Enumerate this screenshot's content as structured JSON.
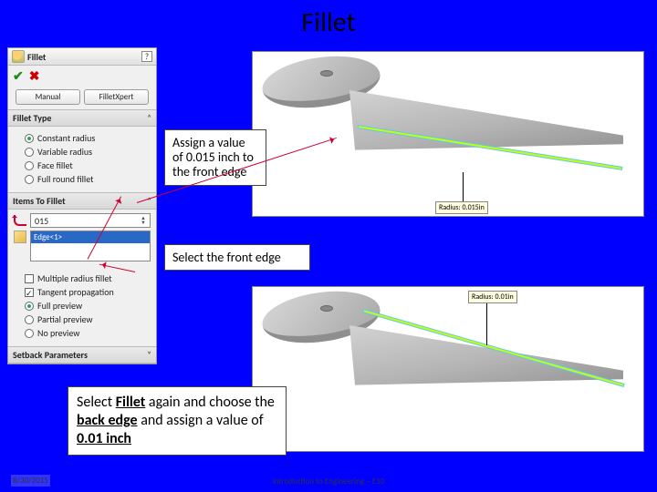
{
  "slide": {
    "title": "Fillet"
  },
  "panel": {
    "title": "Fillet",
    "help": "?",
    "tabs": {
      "manual": "Manual",
      "xpert": "FilletXpert"
    },
    "sections": {
      "type": {
        "header": "Fillet Type",
        "options": {
          "constant": "Constant radius",
          "variable": "Variable radius",
          "face": "Face fillet",
          "full": "Full round fillet"
        }
      },
      "items": {
        "header": "Items To Fillet",
        "value": "015",
        "edge": "Edge<1>",
        "multiple": "Multiple radius fillet",
        "tangent": "Tangent propagation",
        "preview": {
          "full": "Full preview",
          "partial": "Partial preview",
          "none": "No preview"
        }
      },
      "setback": {
        "header": "Setback Parameters"
      }
    }
  },
  "callouts": {
    "assign": "Assign a value of 0.015 inch to the front edge",
    "select_front": "Select the front edge",
    "again": {
      "p1": "Select ",
      "b1": "Fillet",
      "p2": " again and choose the ",
      "b2": "back edge",
      "p3": " and assign a value of ",
      "b3": "0.01 inch"
    }
  },
  "viewport": {
    "radius1": "Radius: 0.015in",
    "radius2": "Radius: 0.01in"
  },
  "footer": {
    "date": "8/30/2015",
    "course": "Introduction to Engineering – E10"
  }
}
